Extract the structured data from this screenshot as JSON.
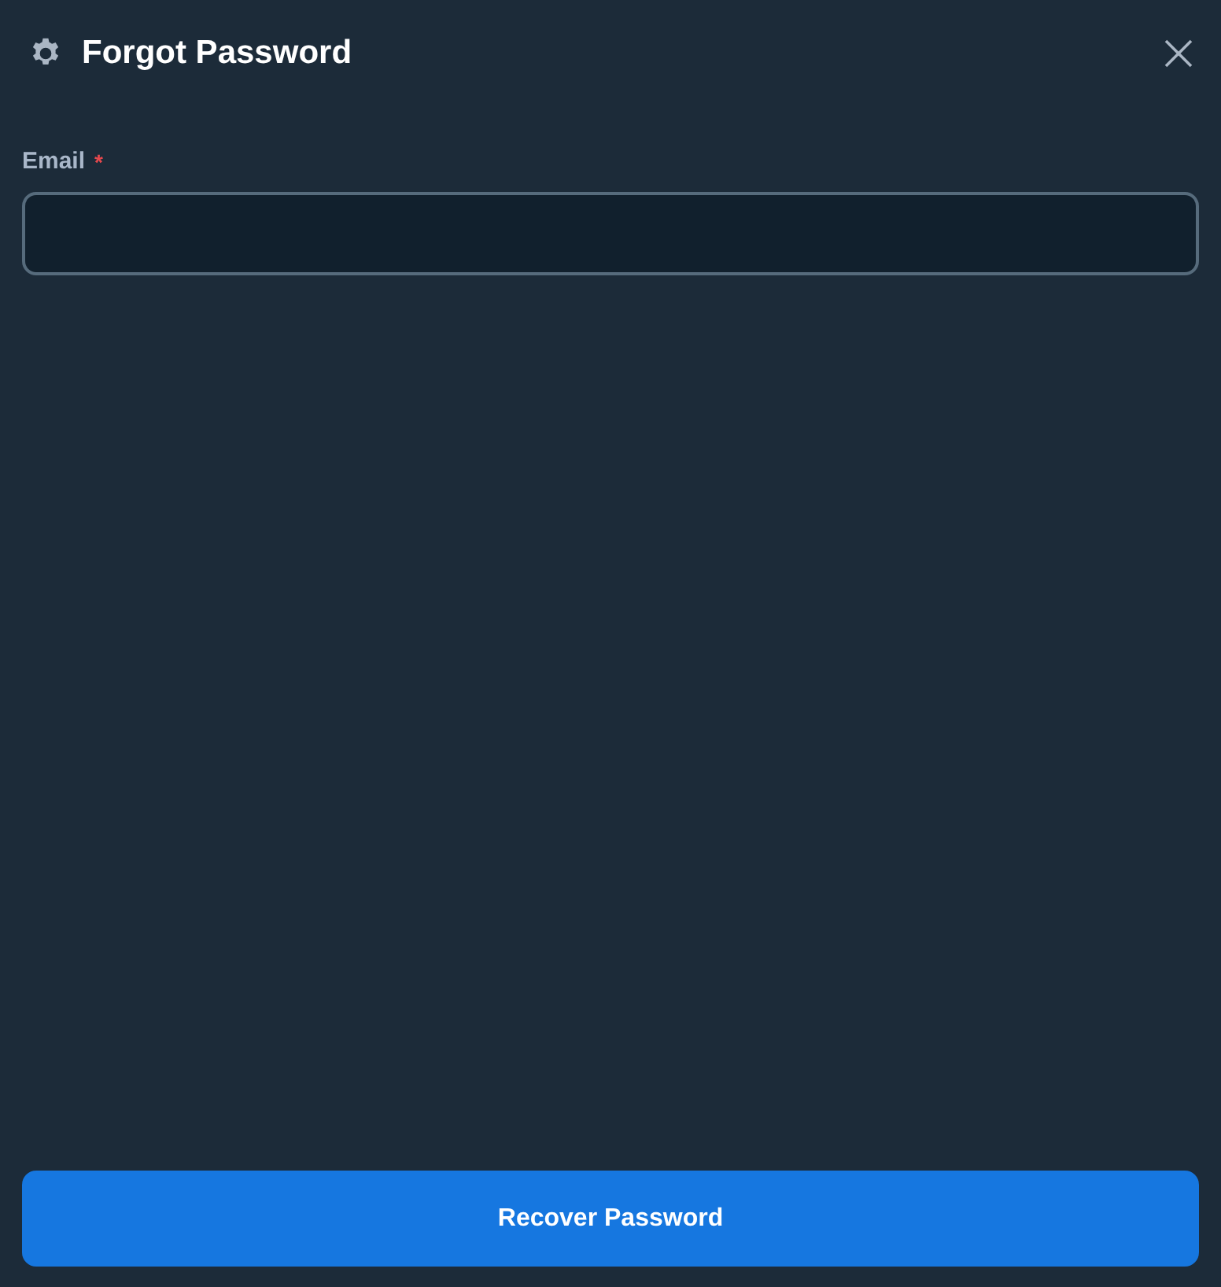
{
  "dialog": {
    "title": "Forgot Password"
  },
  "form": {
    "email": {
      "label": "Email",
      "required_mark": "*"
    }
  },
  "submit_button": {
    "label": "Recover Password"
  }
}
